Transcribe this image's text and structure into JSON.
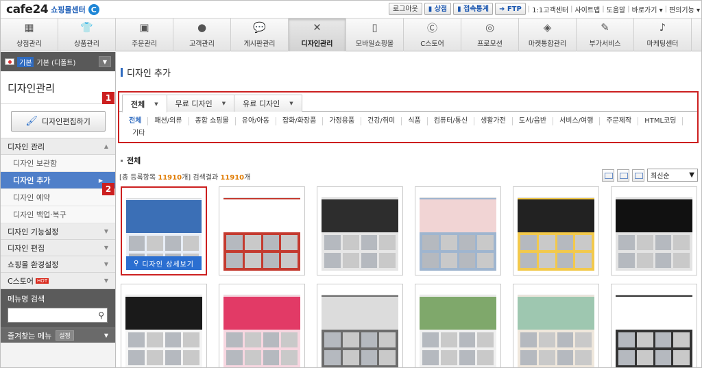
{
  "header": {
    "logo_text": "cafe24",
    "logo_sub": "쇼핑몰센터",
    "logo_badge": "C",
    "logout": "로그아웃",
    "sangjum": "상점",
    "stats": "접속통계",
    "ftp": "FTP",
    "links": [
      "1:1고객센터",
      "사이트맵",
      "도움말",
      "바로가기 ▾",
      "편의기능 ▾"
    ]
  },
  "nav": {
    "items": [
      {
        "label": "상점관리",
        "icon": "store-icon"
      },
      {
        "label": "상품관리",
        "icon": "shirt-icon"
      },
      {
        "label": "주문관리",
        "icon": "box-icon"
      },
      {
        "label": "고객관리",
        "icon": "person-icon"
      },
      {
        "label": "게시판관리",
        "icon": "speech-icon"
      },
      {
        "label": "디자인관리",
        "icon": "design-tools-icon"
      },
      {
        "label": "모바일쇼핑몰",
        "icon": "mobile-icon"
      },
      {
        "label": "C스토어",
        "icon": "cstore-icon"
      },
      {
        "label": "프로모션",
        "icon": "promotion-icon"
      },
      {
        "label": "마켓통합관리",
        "icon": "cube-icon"
      },
      {
        "label": "부가서비스",
        "icon": "pen-icon"
      },
      {
        "label": "마케팅센터",
        "icon": "mic-icon"
      }
    ],
    "active_index": 5
  },
  "sidebar": {
    "base_tag": "기본",
    "shop_name": "기본 (디폴트)",
    "title": "디자인관리",
    "edit_button": "디자인편집하기",
    "design_section": "디자인 관리",
    "sub_items": [
      "디자인 보관함",
      "디자인 추가",
      "디자인 예약",
      "디자인 백업·복구"
    ],
    "active_sub": 1,
    "sections": [
      "디자인 기능설정",
      "디자인 편집",
      "쇼핑몰 환경설정",
      "C스토어"
    ],
    "hot_label": "HOT",
    "menu_search_label": "메뉴명 검색",
    "menu_search_placeholder": "",
    "favorites_label": "즐겨찾는 메뉴",
    "favorites_setting": "설정"
  },
  "content": {
    "page_title": "디자인 추가",
    "tabs": [
      "전체",
      "무료 디자인",
      "유료 디자인"
    ],
    "active_tab": 0,
    "categories": [
      "전체",
      "패션/의류",
      "종합 쇼핑몰",
      "유아/아동",
      "잡화/화장품",
      "가정용품",
      "건강/취미",
      "식품",
      "컴퓨터/통신",
      "생활가전",
      "도서/음반",
      "서비스/여행",
      "주문제작",
      "HTML코딩",
      "기타"
    ],
    "list_title": "전체",
    "count_prefix": "[총 등록항목 ",
    "count_total": "11910",
    "count_mid": "개] 검색결과 ",
    "count_result": "11910",
    "count_suffix": "개",
    "sort_value": "최신순",
    "detail_button": "디자인 상세보기",
    "badge1": "1",
    "badge2": "2",
    "accent_red": "#cc1f1f",
    "accent_blue": "#2b6fd1"
  }
}
